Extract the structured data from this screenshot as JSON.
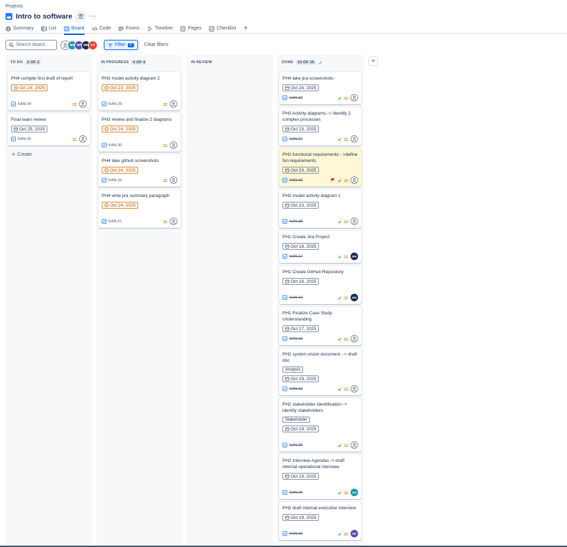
{
  "header": {
    "breadcrumb": "Projects",
    "project_title": "Intro to software",
    "more": "···"
  },
  "tabs": [
    {
      "label": "Summary",
      "icon": "globe-icon",
      "active": false
    },
    {
      "label": "List",
      "icon": "list-icon",
      "active": false
    },
    {
      "label": "Board",
      "icon": "board-icon",
      "active": true
    },
    {
      "label": "Code",
      "icon": "code-icon",
      "active": false
    },
    {
      "label": "Forms",
      "icon": "forms-icon",
      "active": false
    },
    {
      "label": "Timeline",
      "icon": "timeline-icon",
      "active": false
    },
    {
      "label": "Pages",
      "icon": "pages-icon",
      "active": false
    },
    {
      "label": "Checklist",
      "icon": "checklist-icon",
      "active": false
    }
  ],
  "toolbar": {
    "search_placeholder": "Search board",
    "avatars": [
      {
        "initials": "",
        "color": "#ffffff",
        "type": "unassigned"
      },
      {
        "initials": "MN",
        "color": "#1d9aaa"
      },
      {
        "initials": "MP",
        "color": "#5e4db2"
      },
      {
        "initials": "MM",
        "color": "#172b4d"
      },
      {
        "initials": "CA",
        "color": "#e34935"
      }
    ],
    "filter_label": "Filter",
    "filter_count": "5",
    "clear_label": "Clear filters"
  },
  "colors": {
    "accent": "#0c66e4",
    "due_border": "#e2861b",
    "done_check": "#22a06b",
    "priority": "#e2861b",
    "flag": "#c9372c"
  },
  "columns": [
    {
      "name": "TO DO",
      "count": "2 OF 2",
      "create_label": "Create",
      "cards": [
        {
          "title": "PH4 compile first draft of report",
          "date": "Oct 24, 2025",
          "due": true,
          "key": "KAN-34",
          "done": false,
          "assignee": "unassigned"
        },
        {
          "title": "Final team review",
          "date": "Oct 25, 2025",
          "due": false,
          "key": "KAN-35",
          "done": false,
          "assignee": "unassigned"
        }
      ]
    },
    {
      "name": "IN PROGRESS",
      "count": "4 OF 4",
      "cards": [
        {
          "title": "PH3 model activity diagram 2",
          "date": "Oct 23, 2025",
          "due": true,
          "key": "KAN-29",
          "done": false,
          "assignee": "unassigned"
        },
        {
          "title": "PH3 review and finalize 2 diagrams",
          "date": "Oct 24, 2025",
          "due": true,
          "key": "KAN-30",
          "done": false,
          "assignee": "unassigned"
        },
        {
          "title": "PH4 take github screenshots",
          "date": "Oct 24, 2025",
          "due": true,
          "key": "KAN-33",
          "done": false,
          "assignee": "unassigned"
        },
        {
          "title": "PH4 write jira summary paragraph",
          "date": "Oct 24, 2025",
          "due": true,
          "key": "KAN-31",
          "done": false,
          "assignee": "unassigned"
        }
      ]
    },
    {
      "name": "IN REVIEW",
      "count": "",
      "cards": []
    },
    {
      "name": "DONE",
      "count": "16 OF 16",
      "cards": [
        {
          "title": "PH4 take jira screenshots",
          "date": "Oct 24, 2025",
          "key": "KAN-32",
          "done": true,
          "assignee": "unassigned"
        },
        {
          "title": "PH3 Activity diagrams -> Identify 2 complex processes",
          "date": "Oct 23, 2025",
          "key": "KAN-27",
          "done": true,
          "assignee": "unassigned"
        },
        {
          "title": "PH2 functional requirements - >define fun requirements",
          "date": "Oct 23, 2025",
          "key": "KAN-22",
          "done": true,
          "assignee": "unassigned",
          "flagged": true
        },
        {
          "title": "PH3 model activity diagram 1",
          "date": "Oct 23, 2025",
          "key": "KAN-28",
          "done": true,
          "assignee": "unassigned"
        },
        {
          "title": "PH1 Create Jira Project",
          "date": "Oct 16, 2025",
          "key": "KAN-17",
          "done": true,
          "assignee": "MM",
          "assignee_color": "#172b4d"
        },
        {
          "title": "PH1 Create GitHub Repository",
          "date": "Oct 16, 2025",
          "key": "KAN-16",
          "done": true,
          "assignee": "MM",
          "assignee_color": "#172b4d"
        },
        {
          "title": "PH1 Finalize Case Study Understanding",
          "date": "Oct 17, 2025",
          "key": "KAN-18",
          "done": true,
          "assignee": "unassigned"
        },
        {
          "title": "PH2 system vision document - > draft doc",
          "label": "Analysis",
          "date": "Oct 19, 2025",
          "key": "KAN-19",
          "done": true,
          "assignee": "unassigned"
        },
        {
          "title": "PH2 stakeholder identification -> identify stakeholders",
          "label": "Stakeholder",
          "date": "Oct 19, 2025",
          "key": "KAN-20",
          "done": true,
          "assignee": "unassigned"
        },
        {
          "title": "PH2 Interview Agendas -> draft internal operational interview",
          "date": "Oct 19, 2025",
          "key": "KAN-25",
          "done": true,
          "assignee": "MN",
          "assignee_color": "#1d9aaa"
        },
        {
          "title": "PH2 draft internal executive interview",
          "date": "Oct 19, 2025",
          "key": "KAN-26",
          "done": true,
          "assignee": "MP",
          "assignee_color": "#5e4db2"
        }
      ]
    }
  ]
}
